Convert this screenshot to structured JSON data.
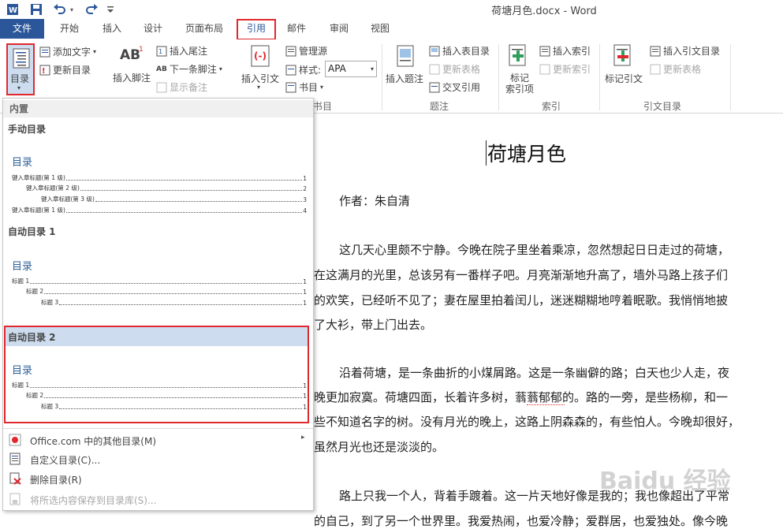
{
  "window": {
    "title": "荷塘月色.docx - Word"
  },
  "tabs": [
    {
      "label": "文件"
    },
    {
      "label": "开始"
    },
    {
      "label": "插入"
    },
    {
      "label": "设计"
    },
    {
      "label": "页面布局"
    },
    {
      "label": "引用"
    },
    {
      "label": "邮件"
    },
    {
      "label": "审阅"
    },
    {
      "label": "视图"
    }
  ],
  "ribbon": {
    "toc": {
      "big": "目录",
      "add_text": "添加文字",
      "update": "更新目录"
    },
    "footnotes": {
      "insert_footnote": "插入脚注",
      "insert_endnote": "插入尾注",
      "next_footnote": "下一条脚注",
      "show_notes": "显示备注",
      "big_icon": "AB"
    },
    "citations": {
      "insert_citation": "插入引文",
      "manage_sources": "管理源",
      "style_label": "样式:",
      "style_value": "APA",
      "bibliography": "书目",
      "group": "书目"
    },
    "captions": {
      "insert_caption": "插入题注",
      "insert_table_of_figures": "插入表目录",
      "update_table": "更新表格",
      "cross_reference": "交叉引用",
      "group": "题注"
    },
    "index": {
      "mark_entry_1": "标记",
      "mark_entry_2": "索引项",
      "insert_index": "插入索引",
      "update_index": "更新索引",
      "group": "索引"
    },
    "authorities": {
      "mark_citation": "标记引文",
      "insert_toa": "插入引文目录",
      "update_table": "更新表格",
      "group": "引文目录"
    }
  },
  "dropdown": {
    "section_builtin": "内置",
    "manual_title": "手动目录",
    "manual_toc_heading": "目录",
    "manual_rows": [
      {
        "text": "键入章标题(第 1 级)",
        "page": "1"
      },
      {
        "text": "键入章标题(第 2 级)",
        "page": "2"
      },
      {
        "text": "键入章标题(第 3 级)",
        "page": "3"
      },
      {
        "text": "键入章标题(第 1 级)",
        "page": "4"
      }
    ],
    "auto1_title": "自动目录 1",
    "auto1_toc_heading": "目录",
    "auto1_rows": [
      {
        "text": "标题 1",
        "page": "1"
      },
      {
        "text": "标题 2",
        "page": "1"
      },
      {
        "text": "标题 3",
        "page": "1"
      }
    ],
    "auto2_title": "自动目录 2",
    "auto2_toc_heading": "目录",
    "auto2_rows": [
      {
        "text": "标题 1",
        "page": "1"
      },
      {
        "text": "标题 2",
        "page": "1"
      },
      {
        "text": "标题 3",
        "page": "1"
      }
    ],
    "menu": [
      {
        "label": "Office.com 中的其他目录(M)",
        "icon": "office-icon"
      },
      {
        "label": "自定义目录(C)...",
        "icon": "document-icon"
      },
      {
        "label": "删除目录(R)",
        "icon": "delete-icon"
      },
      {
        "label": "将所选内容保存到目录库(S)...",
        "icon": "save-icon"
      }
    ]
  },
  "document": {
    "title": "荷塘月色",
    "author": "作者：朱自清",
    "lines": [
      "这几天心里颇不宁静。今晚在院子里坐着乘凉，忽然想起日日走过的荷塘，",
      "在这满月的光里，总该另有一番样子吧。月亮渐渐地升高了，墙外马路上孩子们",
      "的欢笑，已经听不见了；妻在屋里拍着闰儿，迷迷糊糊地哼着眠歌。我悄悄地披",
      "了大衫，带上门出去。",
      "沿着荷塘，是一条曲折的小煤屑路。这是一条幽僻的路；白天也少人走，夜",
      "晚更加寂寞。荷塘四面，长着许多树，蓊蓊郁郁的。路的一旁，是些杨柳，和一",
      "些不知道名字的树。没有月光的晚上，这路上阴森森的，有些怕人。今晚却很好，",
      "虽然月光也还是淡淡的。",
      "路上只我一个人，背着手踱着。这一片天地好像是我的；我也像超出了平常",
      "的自己，到了另一个世界里。我爱热闹，也爱冷静；爱群居，也爱独处。像今晚"
    ]
  },
  "watermark": "Baidu 经验",
  "colors": {
    "accent": "#2b579a",
    "highlight": "#e0282e",
    "selected": "#cddcef"
  }
}
